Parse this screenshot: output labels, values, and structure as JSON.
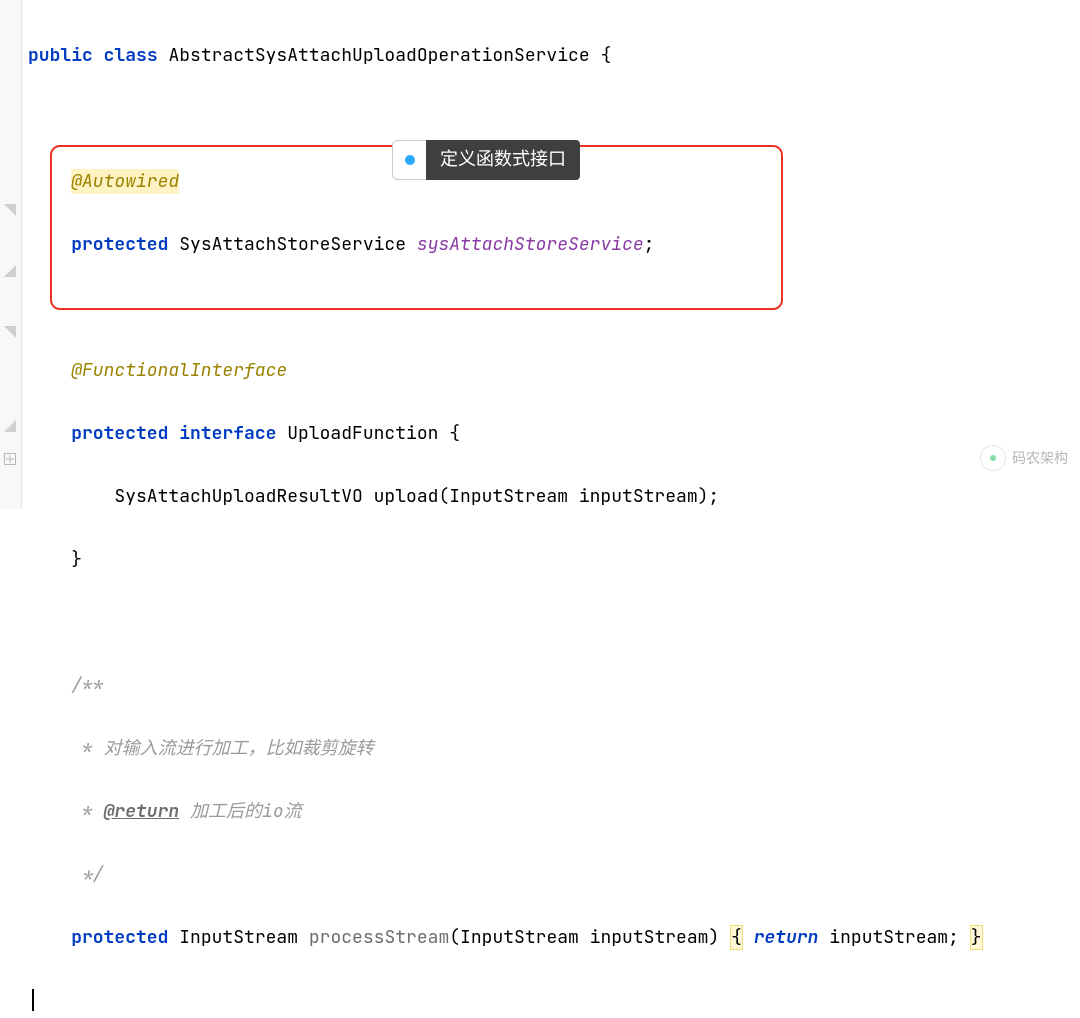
{
  "code": {
    "kw_public": "public",
    "kw_class": "class",
    "cls_name": "AbstractSysAttachUploadOperationService",
    "brace_open": "{",
    "anno_autowired": "@Autowired",
    "kw_protected": "protected",
    "type_store": "SysAttachStoreService",
    "fld_store": "sysAttachStoreService",
    "semi": ";",
    "anno_funcif": "@FunctionalInterface",
    "kw_interface": "interface",
    "if_name": "UploadFunction",
    "ret_type": "SysAttachUploadResultVO",
    "m_upload": "upload",
    "param1": "(InputStream inputStream);",
    "brace_close": "}",
    "cmt_open": "/**",
    "cmt_l1": " * 对输入流进行加工，比如裁剪旋转",
    "cmt_l2a": " * ",
    "cmt_tag": "@return",
    "cmt_l2b": " 加工后的io流",
    "cmt_close": " */",
    "type_is": "InputStream",
    "m_process": "processStream",
    "param2a": "(InputStream inputStream) ",
    "brace_open2": "{",
    "kw_return": "return",
    "tail": " inputStream; ",
    "brace_close2": "}"
  },
  "callout": {
    "label": "定义函数式接口"
  },
  "watermark": {
    "text": "码农架构"
  }
}
